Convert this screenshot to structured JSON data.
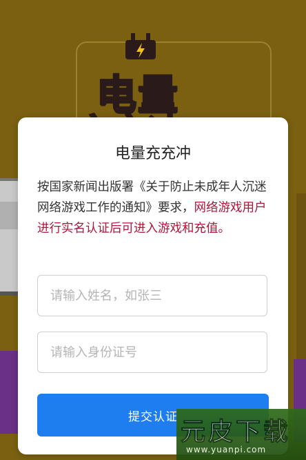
{
  "background": {
    "game_title": "电量",
    "game_subtitle": "充充冲"
  },
  "dialog": {
    "title": "电量充充冲",
    "notice_prefix": "按国家新闻出版署《关于防止未成年人沉迷网络游戏工作的通知》要求，",
    "notice_highlight": "网络游戏用户进行实名认证后可进入游戏和充值。",
    "name_field": {
      "placeholder": "请输入姓名，如张三",
      "value": ""
    },
    "id_field": {
      "placeholder": "请输入身份证号",
      "value": ""
    },
    "submit_label": "提交认证"
  },
  "watermark": {
    "main": "元皮下载",
    "url": "www.yuanpi.com"
  },
  "colors": {
    "accent_blue": "#1e7ef0",
    "notice_red": "#b0163a",
    "bg_yellow": "#7a6010",
    "title_magenta": "#8a1f4a"
  }
}
